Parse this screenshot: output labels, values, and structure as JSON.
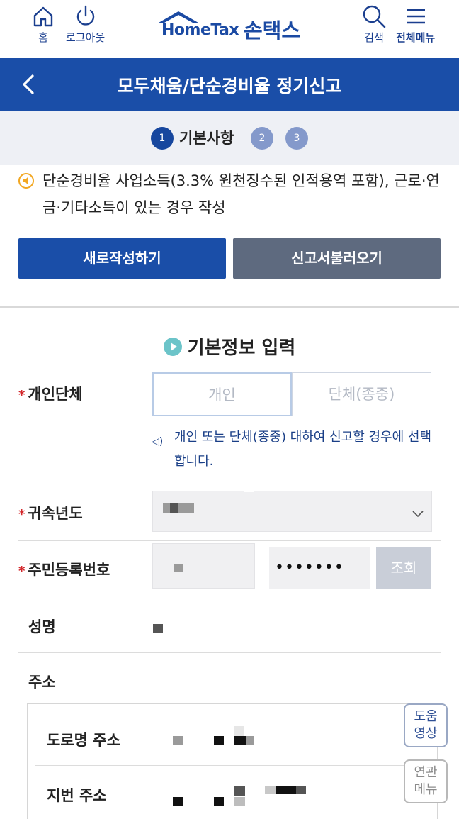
{
  "header": {
    "home_label": "홈",
    "logout_label": "로그아웃",
    "logo_en": "HomeTax",
    "logo_kr": "손택스",
    "search_label": "검색",
    "menu_label": "전체메뉴"
  },
  "titlebar": {
    "title": "모두채움/단순경비율 정기신고"
  },
  "steps": {
    "items": [
      {
        "num": "1",
        "label": "기본사항",
        "active": true
      },
      {
        "num": "2",
        "active": false
      },
      {
        "num": "3",
        "active": false
      }
    ]
  },
  "notice": {
    "text": "단순경비율 사업소득(3.3% 원천징수된 인적용역 포함), 근로·연금·기타소득이 있는 경우 작성"
  },
  "actions": {
    "new_label": "새로작성하기",
    "load_label": "신고서불러오기"
  },
  "section": {
    "title": "기본정보 입력"
  },
  "form": {
    "type": {
      "label": "개인단체",
      "options": [
        "개인",
        "단체(종중)"
      ],
      "selected": "개인",
      "hint": "개인 또는 단체(종중) 대하여 신고할 경우에 선택합니다."
    },
    "year": {
      "label": "귀속년도"
    },
    "rrn": {
      "label": "주민등록번호",
      "masked_back": "•••••••",
      "lookup_label": "조회"
    },
    "name": {
      "label": "성명"
    },
    "address": {
      "label": "주소",
      "road_label": "도로명 주소",
      "lot_label": "지번 주소"
    }
  },
  "floating": {
    "help_video": [
      "도움",
      "영상"
    ],
    "related_menu": [
      "연관",
      "메뉴"
    ]
  },
  "colors": {
    "primary": "#1a4ea8",
    "secondary_button": "#5e6a7f",
    "required": "#d3282c",
    "accent_teal": "#6cc4c9"
  }
}
